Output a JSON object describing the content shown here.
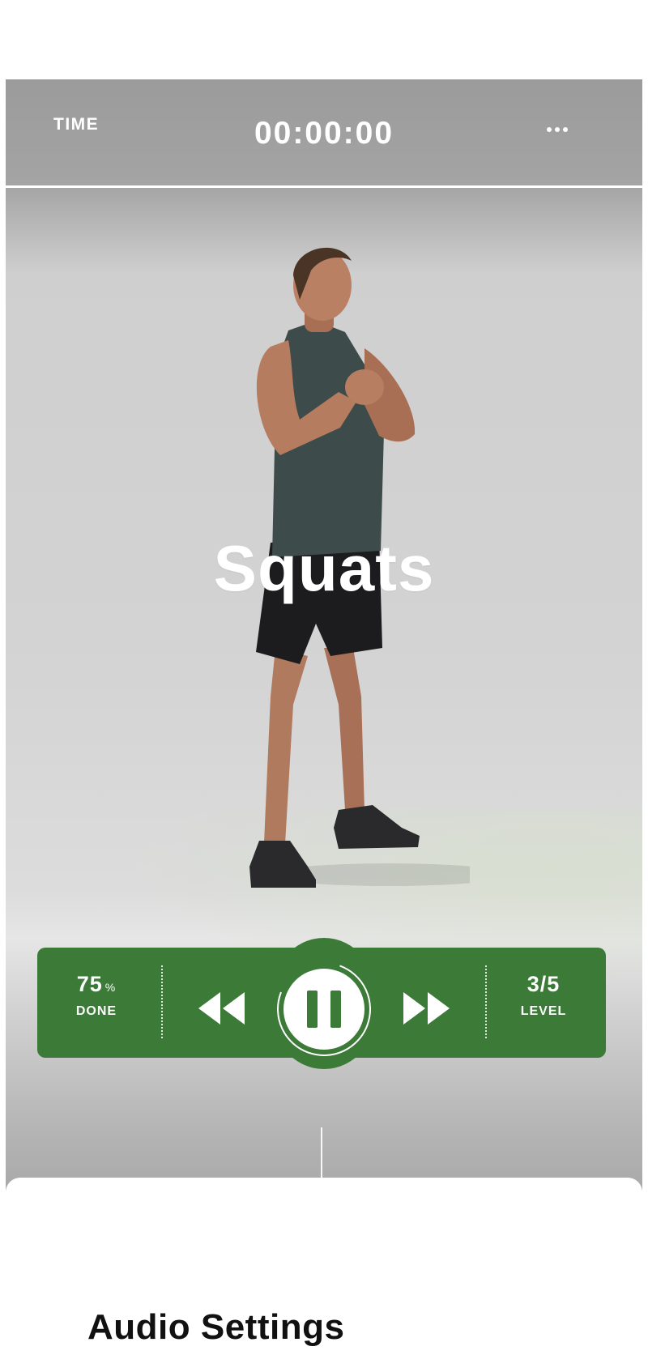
{
  "header": {
    "time_label": "TIME",
    "timer": "00:00:00",
    "more_icon": "more-horizontal-icon"
  },
  "exercise": {
    "title": "Squats"
  },
  "controls": {
    "progress_value": "75",
    "progress_unit": "%",
    "progress_label": "DONE",
    "progress_fraction": 0.75,
    "level_value": "3/5",
    "level_label": "LEVEL",
    "rewind_icon": "rewind-icon",
    "pause_icon": "pause-icon",
    "forward_icon": "fast-forward-icon"
  },
  "sheet": {
    "title": "Audio Settings"
  },
  "colors": {
    "accent": "#3b7a37",
    "text_on_accent": "#ffffff"
  }
}
